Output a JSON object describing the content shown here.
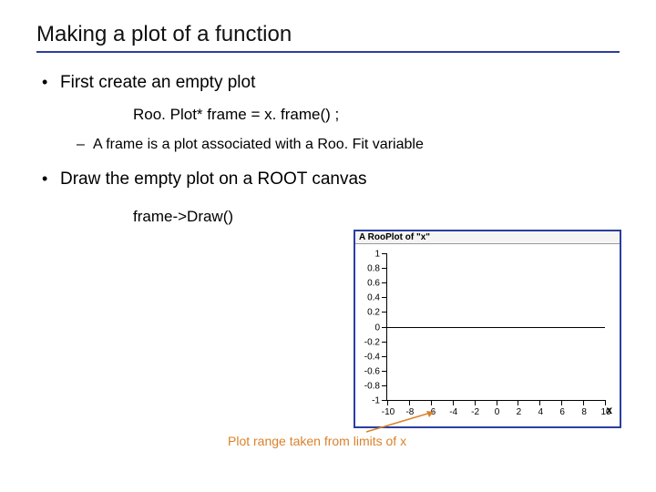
{
  "title": "Making a plot of a function",
  "bullets": {
    "b1": "First create an empty plot",
    "code1": "Roo. Plot* frame = x. frame() ;",
    "sub1": "A frame is a plot associated with a Roo. Fit variable",
    "b2": "Draw the empty plot on a ROOT canvas",
    "code2": "frame->Draw()"
  },
  "plot": {
    "title": "A RooPlot of \"x\"",
    "xaxis_label": "x"
  },
  "caption": "Plot range taken from limits of x",
  "chart_data": {
    "type": "line",
    "title": "A RooPlot of \"x\"",
    "xlabel": "x",
    "ylabel": "",
    "x_ticks": [
      -10,
      -8,
      -6,
      -4,
      -2,
      0,
      2,
      4,
      6,
      8,
      10
    ],
    "y_ticks": [
      -1,
      -0.8,
      -0.6,
      -0.4,
      -0.2,
      0,
      0.2,
      0.4,
      0.6,
      0.8,
      1
    ],
    "xlim": [
      -10,
      10
    ],
    "ylim": [
      -1,
      1
    ],
    "series": []
  }
}
